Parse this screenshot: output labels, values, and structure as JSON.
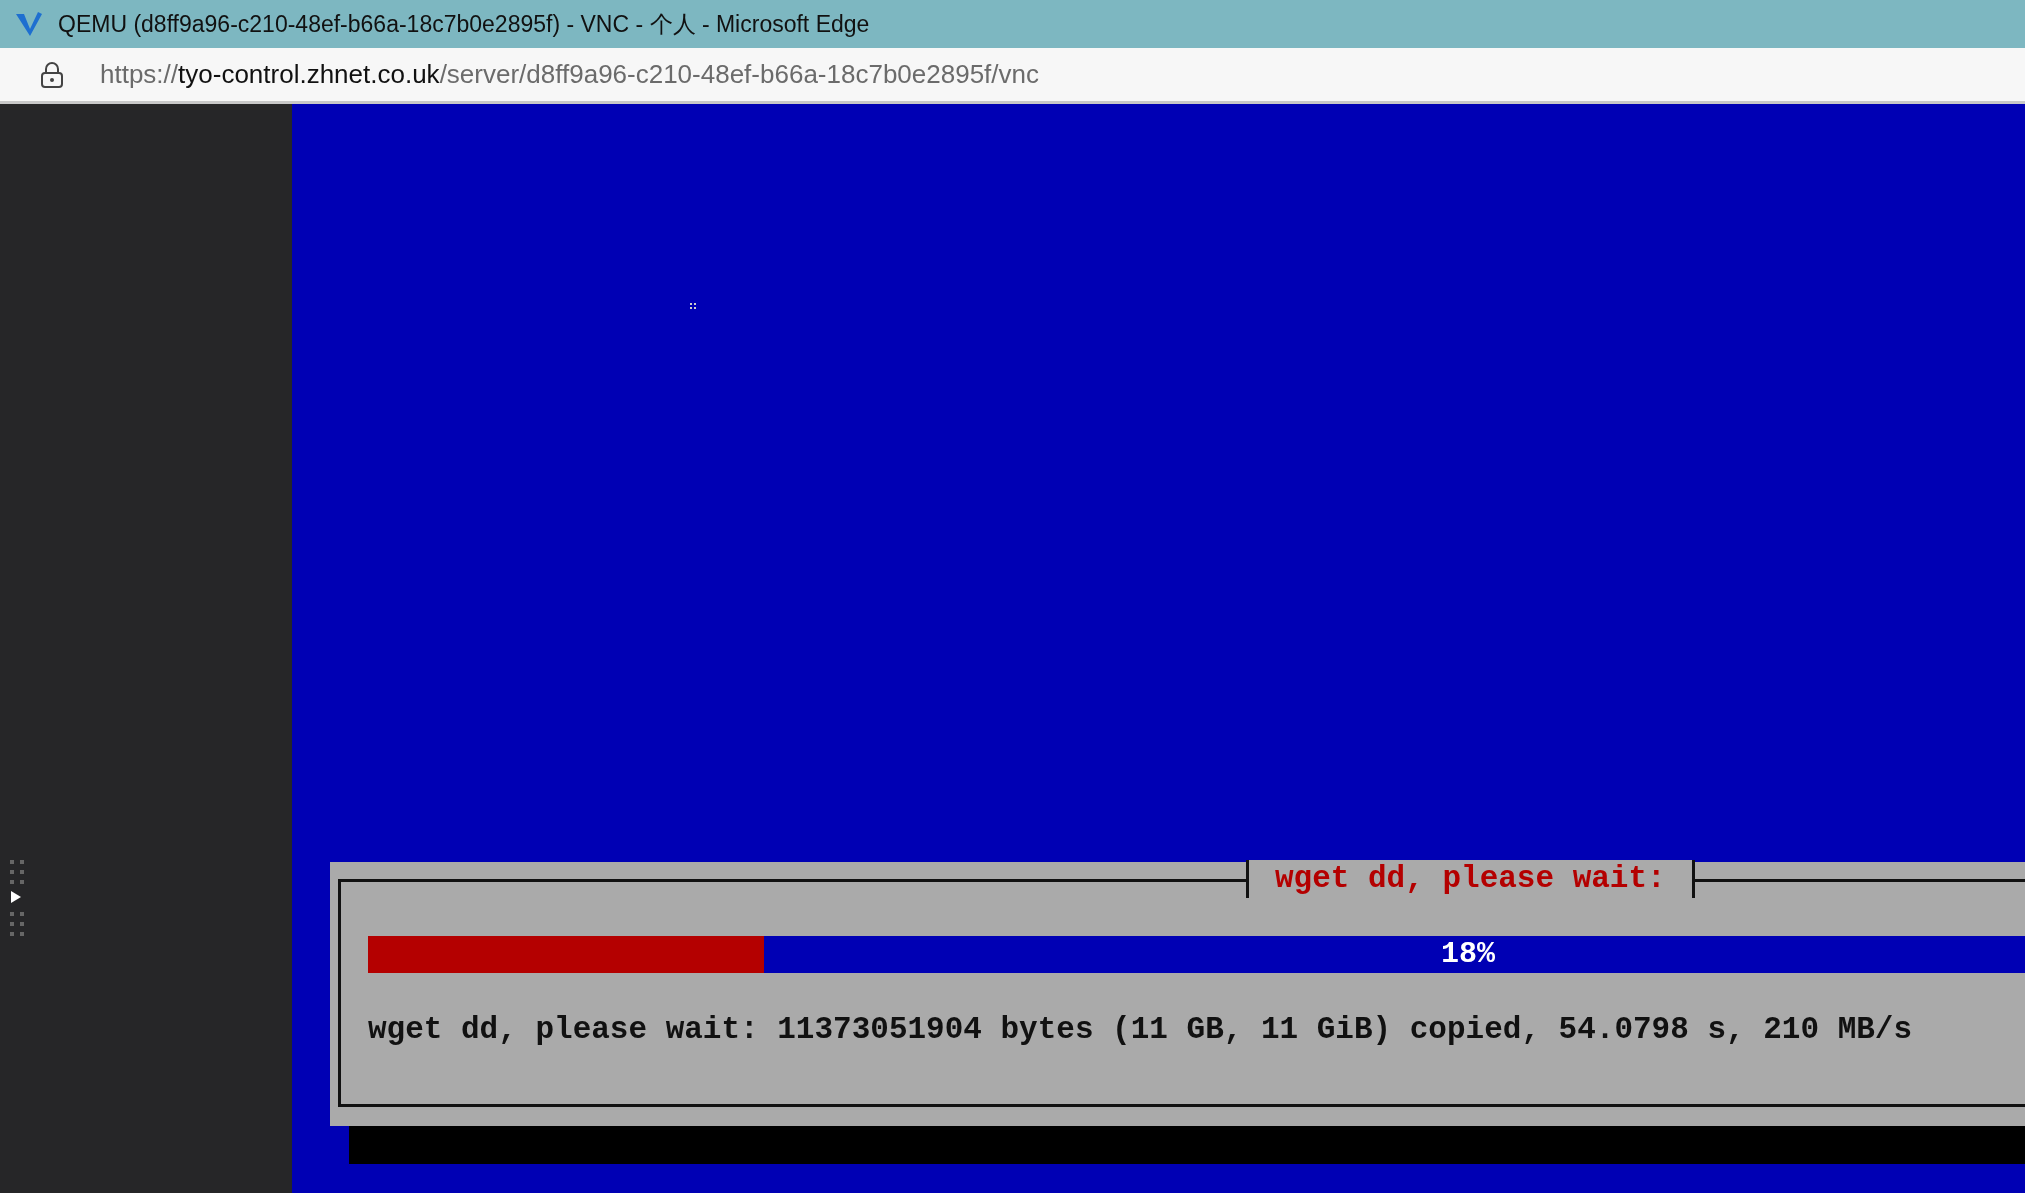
{
  "window": {
    "title": "QEMU (d8ff9a96-c210-48ef-b66a-18c7b0e2895f) - VNC - 个人 - Microsoft Edge"
  },
  "address_bar": {
    "scheme": "https://",
    "host": "tyo-control.zhnet.co.uk",
    "path": "/server/d8ff9a96-c210-48ef-b66a-18c7b0e2895f/vnc"
  },
  "vnc_screen": {
    "dialog": {
      "title": "wget dd, please wait:",
      "progress": {
        "level": 0.18,
        "label": "18%"
      },
      "message": "wget dd, please wait: 11373051904 bytes (11 GB, 11 GiB) copied, 54.0798 s, 210 MB/s"
    }
  }
}
